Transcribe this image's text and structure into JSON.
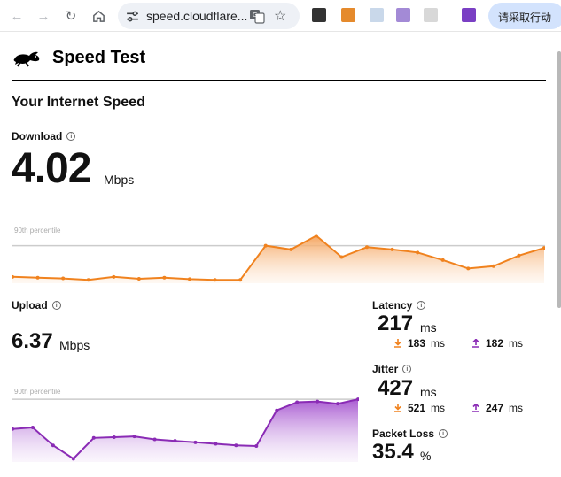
{
  "browser": {
    "url": "speed.cloudflare...",
    "cta_label": "请采取行动"
  },
  "header": {
    "title": "Speed Test"
  },
  "section_title": "Your Internet Speed",
  "download": {
    "label": "Download",
    "value": "4.02",
    "unit": "Mbps",
    "percentile_label": "90th percentile"
  },
  "upload": {
    "label": "Upload",
    "value": "6.37",
    "unit": "Mbps",
    "percentile_label": "90th percentile"
  },
  "latency": {
    "label": "Latency",
    "value": "217",
    "unit": "ms",
    "down_value": "183",
    "up_value": "182",
    "sub_unit": "ms"
  },
  "jitter": {
    "label": "Jitter",
    "value": "427",
    "unit": "ms",
    "down_value": "521",
    "up_value": "247",
    "sub_unit": "ms"
  },
  "packet_loss": {
    "label": "Packet Loss",
    "value": "35.4",
    "unit": "%"
  },
  "colors": {
    "download": "#f0821e",
    "upload": "#8a2bb5",
    "percentile_line": "#cccccc"
  },
  "icons": {
    "site_info": "tune-icon",
    "translate": "translate-icon",
    "star": "star-icon",
    "download_arrow": "download-arrow-icon",
    "upload_arrow": "upload-arrow-icon"
  },
  "chart_data": [
    {
      "type": "area",
      "name": "Download",
      "values": [
        0.06,
        0.05,
        0.04,
        0.02,
        0.06,
        0.035,
        0.05,
        0.03,
        0.02,
        0.02,
        0.47,
        0.42,
        0.6,
        0.32,
        0.45,
        0.42,
        0.38,
        0.28,
        0.17,
        0.2,
        0.34,
        0.44
      ],
      "percentile": 0.47
    },
    {
      "type": "area",
      "name": "Upload",
      "values": [
        0.42,
        0.44,
        0.2,
        0.02,
        0.3,
        0.31,
        0.32,
        0.28,
        0.26,
        0.24,
        0.22,
        0.2,
        0.19,
        0.67,
        0.78,
        0.79,
        0.76,
        0.82
      ],
      "percentile": 0.82
    }
  ]
}
